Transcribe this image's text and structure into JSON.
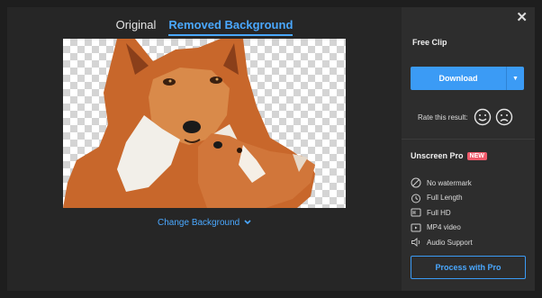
{
  "tabs": [
    {
      "label": "Original",
      "active": false
    },
    {
      "label": "Removed Background",
      "active": true
    }
  ],
  "preview": {
    "subject": "fox-cutout-image"
  },
  "change_background": {
    "label": "Change Background",
    "icon": "chevron-down-icon"
  },
  "panel": {
    "close_icon": "close-icon",
    "clip_title": "Free Clip",
    "download_label": "Download",
    "download_dropdown_icon": "caret-down-icon",
    "rate_label": "Rate this result:",
    "rate_icons": [
      "smile-face-icon",
      "sad-face-icon"
    ],
    "pro": {
      "title": "Unscreen Pro",
      "badge": "NEW",
      "features": [
        {
          "label": "No watermark",
          "icon": "no-watermark-icon"
        },
        {
          "label": "Full Length",
          "icon": "timer-icon"
        },
        {
          "label": "Full HD",
          "icon": "hd-icon"
        },
        {
          "label": "MP4 video",
          "icon": "video-icon"
        },
        {
          "label": "Audio Support",
          "icon": "speaker-icon"
        }
      ],
      "button_label": "Process with Pro"
    }
  },
  "colors": {
    "accent": "#3b9bf5",
    "badge": "#f05a6b",
    "background": "#1e1e1e",
    "panel": "#2d2d2d"
  }
}
